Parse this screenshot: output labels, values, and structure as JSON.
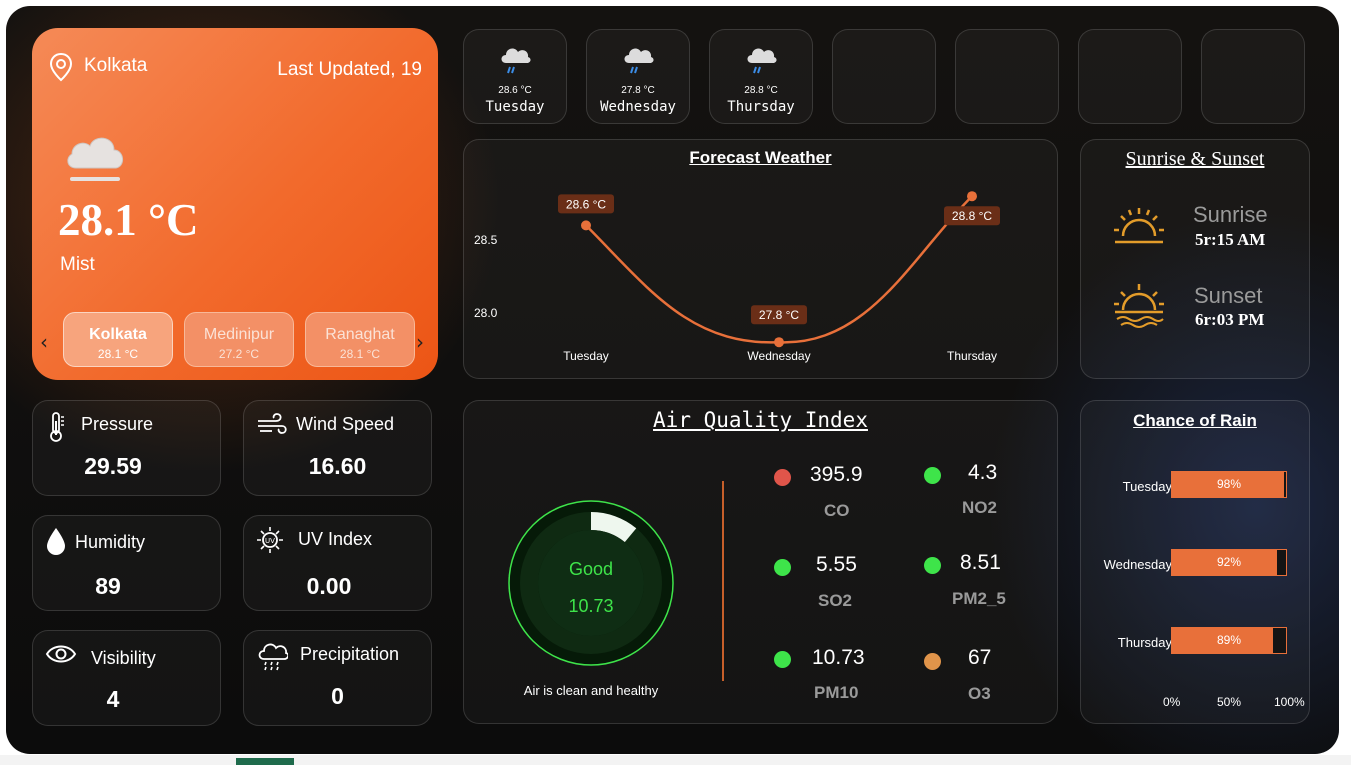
{
  "main": {
    "city": "Kolkata",
    "last_updated": "Last Updated, 19",
    "temperature": "28.1 °C",
    "condition": "Mist",
    "prev_arrow": "‹",
    "next_arrow": "›",
    "locations": [
      {
        "name": "Kolkata",
        "temp": "28.1 °C"
      },
      {
        "name": "Medinipur",
        "temp": "27.2 °C"
      },
      {
        "name": "Ranaghat",
        "temp": "28.1 °C"
      }
    ]
  },
  "forecast_days": [
    {
      "temp": "28.6 °C",
      "day": "Tuesday",
      "icon": "rain-cloud-icon"
    },
    {
      "temp": "27.8 °C",
      "day": "Wednesday",
      "icon": "rain-cloud-icon"
    },
    {
      "temp": "28.8 °C",
      "day": "Thursday",
      "icon": "rain-cloud-icon"
    }
  ],
  "stats": {
    "pressure": {
      "label": "Pressure",
      "value": "29.59",
      "icon": "thermometer-icon"
    },
    "wind": {
      "label": "Wind Speed",
      "value": "16.60",
      "icon": "wind-icon"
    },
    "humidity": {
      "label": "Humidity",
      "value": "89",
      "icon": "droplet-icon"
    },
    "uv": {
      "label": "UV Index",
      "value": "0.00",
      "icon": "uv-icon"
    },
    "visibility": {
      "label": "Visibility",
      "value": "4",
      "icon": "eye-icon"
    },
    "precipitation": {
      "label": "Precipitation",
      "value": "0",
      "icon": "rain-cloud-icon"
    }
  },
  "sun": {
    "title": "Sunrise & Sunset",
    "sunrise_label": "Sunrise",
    "sunrise_time": "5r:15 AM",
    "sunset_label": "Sunset",
    "sunset_time": "6r:03 PM"
  },
  "aqi": {
    "title": "Air Quality Index",
    "status": "Good",
    "value": "10.73",
    "gauge_fraction": 0.11,
    "message": "Air is clean and healthy",
    "pollutants": [
      {
        "name": "CO",
        "value": "395.9",
        "color": "#e0554a"
      },
      {
        "name": "NO2",
        "value": "4.3",
        "color": "#3ee44a"
      },
      {
        "name": "SO2",
        "value": "5.55",
        "color": "#3ee44a"
      },
      {
        "name": "PM2_5",
        "value": "8.51",
        "color": "#3ee44a"
      },
      {
        "name": "PM10",
        "value": "10.73",
        "color": "#3ee44a"
      },
      {
        "name": "O3",
        "value": "67",
        "color": "#e0944a"
      }
    ]
  },
  "chart_data": [
    {
      "type": "line",
      "title": "Forecast Weather",
      "categories": [
        "Tuesday",
        "Wednesday",
        "Thursday"
      ],
      "values": [
        28.6,
        27.8,
        28.8
      ],
      "data_labels": [
        "28.6 °C",
        "27.8 °C",
        "28.8 °C"
      ],
      "y_ticks": [
        "28.5",
        "28.0"
      ],
      "ylim": [
        27.7,
        28.9
      ],
      "color": "#e8703a"
    },
    {
      "type": "bar",
      "title": "Chance of Rain",
      "categories": [
        "Tuesday",
        "Wednesday",
        "Thursday"
      ],
      "values": [
        98,
        92,
        89
      ],
      "data_labels": [
        "98%",
        "92%",
        "89%"
      ],
      "x_ticks": [
        "0%",
        "50%",
        "100%"
      ],
      "xlim": [
        0,
        100
      ],
      "color": "#e8703a"
    }
  ],
  "colors": {
    "accent": "#e8703a",
    "good": "#3ee44a",
    "card_orange": "#f26a2c"
  }
}
